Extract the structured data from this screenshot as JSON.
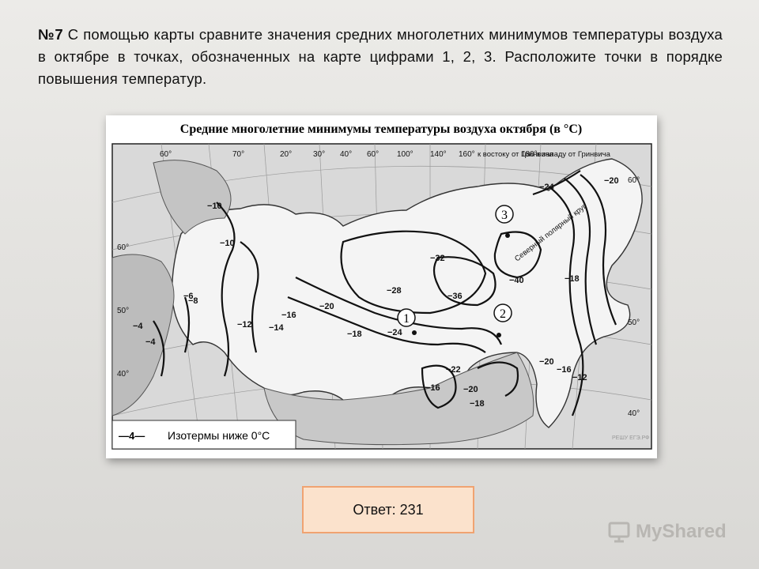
{
  "question": {
    "number": "№7",
    "text": "С помощью карты сравните значения средних многолетних минимумов температуры воздуха в октябре в точках, обозначенных на карте цифрами 1, 2, 3. Расположите точки в порядке повышения температур."
  },
  "map": {
    "title": "Средние многолетние минимумы температуры воздуха октября (в °С)",
    "top_longitudes": [
      "60°",
      "70°",
      "20°",
      "30°",
      "40°",
      "60°",
      "100°",
      "140°",
      "160°"
    ],
    "east_label": "к востоку от Гринвича",
    "east_num": "180°",
    "west_label": "к западу от Гринвича",
    "side_latitudes": [
      "60°",
      "50°",
      "40°",
      "60°",
      "50°",
      "40°"
    ],
    "isotherm_labels": [
      "−10",
      "−10",
      "−24",
      "−20",
      "−32",
      "−36",
      "−40",
      "−28",
      "−18",
      "−20",
      "−18",
      "−24",
      "−22",
      "−20",
      "−16",
      "−12",
      "−14",
      "−16",
      "−18",
      "−12",
      "−16",
      "−20",
      "−8",
      "−4",
      "−4",
      "−6"
    ],
    "arctic_circle": "Северный полярный круг",
    "points": [
      "1",
      "2",
      "3"
    ],
    "legend_sample": "—4—",
    "legend_text": "Изотермы ниже 0°С",
    "watermark": "РЕШУ ЕГЭ.РФ"
  },
  "answer": {
    "text": "Ответ: 231"
  },
  "logo": {
    "text": "MyShared"
  }
}
